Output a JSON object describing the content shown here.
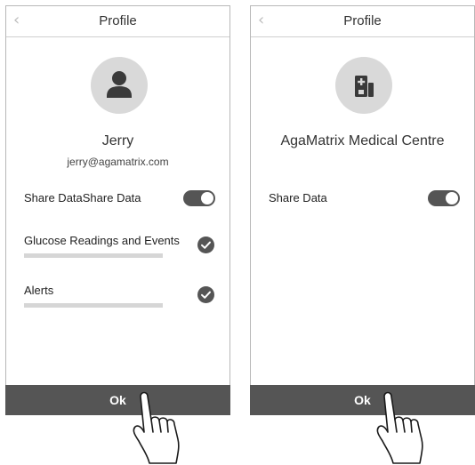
{
  "left_screen": {
    "header": {
      "back_icon": "chevron-left-icon",
      "title": "Profile"
    },
    "avatar_icon": "person-icon",
    "user": {
      "name": "Jerry",
      "email": "jerry@agamatrix.com"
    },
    "share_row": {
      "label": "Share DataShare Data",
      "toggle_on": true
    },
    "items": [
      {
        "label": "Glucose Readings and Events",
        "checked": true
      },
      {
        "label": "Alerts",
        "checked": true
      }
    ],
    "ok_label": "Ok"
  },
  "right_screen": {
    "header": {
      "back_icon": "chevron-left-icon",
      "title": "Profile"
    },
    "avatar_icon": "hospital-icon",
    "clinic_name": "AgaMatrix Medical Centre",
    "share_row": {
      "label": "Share Data",
      "toggle_on": true
    },
    "ok_label": "Ok"
  },
  "colors": {
    "accent_dark": "#555555",
    "avatar_bg": "#d9d9d9",
    "bar_gray": "#d6d6d6",
    "border": "#b8b8b8"
  }
}
